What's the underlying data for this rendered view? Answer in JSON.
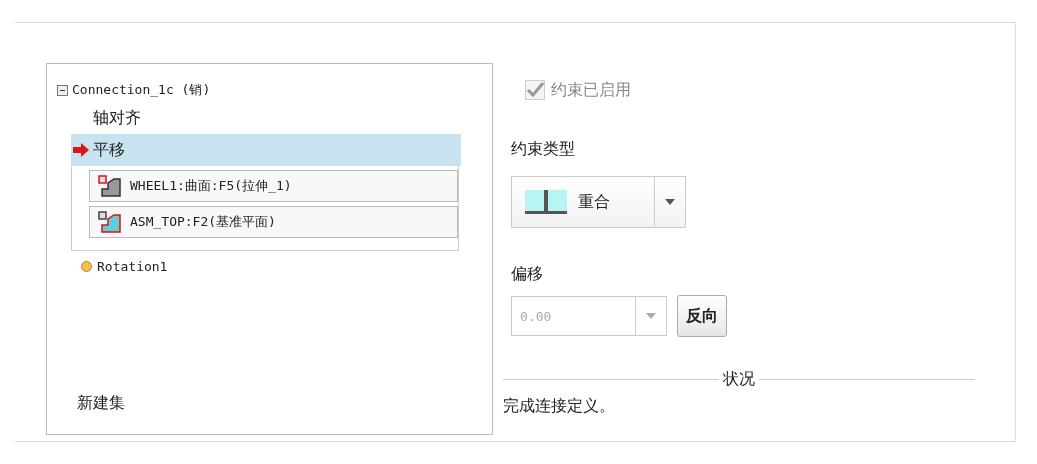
{
  "tree": {
    "label": "Connection_1c (销)",
    "expanded": true,
    "children": [
      {
        "label": "轴对齐",
        "selected": false,
        "current": false
      },
      {
        "label": "平移",
        "selected": true,
        "current": true,
        "references": [
          {
            "label": "WHEEL1:曲面:F5(拉伸_1)",
            "kind": "component"
          },
          {
            "label": "ASM_TOP:F2(基准平面)",
            "kind": "plane"
          }
        ]
      }
    ]
  },
  "sets": [
    {
      "label": "Rotation1",
      "color": "#f7c04a"
    }
  ],
  "new_set": "新建集",
  "enabled": {
    "label": "约束已启用",
    "checked": true,
    "disabled": true
  },
  "constraint_type": {
    "label": "约束类型",
    "value": "重合"
  },
  "offset": {
    "label": "偏移",
    "value": "0.00",
    "disabled": true,
    "button": "反向"
  },
  "status": {
    "title": "状况",
    "message": "完成连接定义。"
  }
}
